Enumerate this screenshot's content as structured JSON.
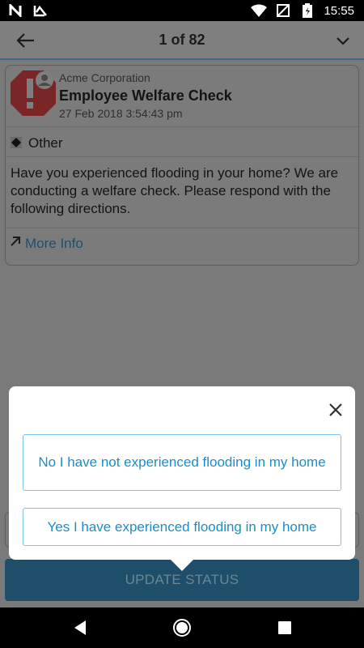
{
  "status_bar": {
    "time": "15:55",
    "left_icons": [
      "n-notification-icon",
      "checkmark-notification-icon"
    ],
    "right_icons": [
      "wifi-icon",
      "no-sim-icon",
      "battery-icon"
    ]
  },
  "app_bar": {
    "title": "1 of 82",
    "back_icon": "arrow-left-icon",
    "menu_icon": "chevron-down-icon"
  },
  "alert": {
    "organization": "Acme Corporation",
    "title": "Employee Welfare Check",
    "date": "27 Feb 2018 3:54:43 pm",
    "category": "Other",
    "message": "Have you experienced flooding in your home? We are conducting a welfare check. Please respond with the following directions.",
    "more_info": "More Info"
  },
  "popup": {
    "options": [
      "No I have not experienced flooding in my home",
      "Yes I have experienced flooding in my home"
    ]
  },
  "update_button": "UPDATE STATUS",
  "colors": {
    "accent": "#1b8ec9",
    "button": "#1f4e6a",
    "logo_red": "#c0302f"
  }
}
